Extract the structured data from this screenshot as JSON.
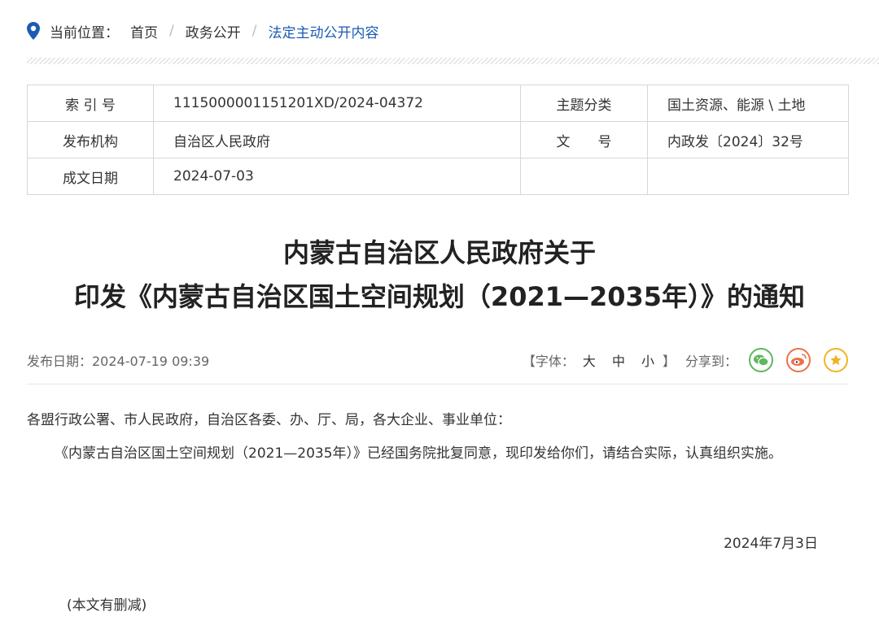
{
  "breadcrumb": {
    "label": "当前位置：",
    "items": [
      "首页",
      "政务公开",
      "法定主动公开内容"
    ],
    "separator": "/"
  },
  "meta": {
    "index_label": "索 引 号",
    "index_value": "1115000001151201XD/2024-04372",
    "topic_label": "主题分类",
    "topic_value": "国土资源、能源 \\ 土地",
    "org_label": "发布机构",
    "org_value": "自治区人民政府",
    "docno_label": "文　　号",
    "docno_value": "内政发〔2024〕32号",
    "date_label": "成文日期",
    "date_value": "2024-07-03"
  },
  "article": {
    "title_line1": "内蒙古自治区人民政府关于",
    "title_line2": "印发《内蒙古自治区国土空间规划（2021—2035年）》的通知",
    "publish_date": "发布日期：2024-07-19 09:39",
    "font_label": "【字体：",
    "font_large": "大",
    "font_medium": "中",
    "font_small": "小",
    "font_end": "】",
    "share_label": "分享到：",
    "salutation": "各盟行政公署、市人民政府，自治区各委、办、厅、局，各大企业、事业单位：",
    "paragraph": "《内蒙古自治区国土空间规划（2021—2035年）》已经国务院批复同意，现印发给你们，请结合实际，认真组织实施。",
    "sign_date": "2024年7月3日",
    "note": "(本文有删减)"
  },
  "icons": {
    "location": "location-pin-icon",
    "wechat": "wechat-icon",
    "weibo": "weibo-icon",
    "favorite": "star-icon"
  },
  "colors": {
    "accent": "#1b5bb3",
    "wechat": "#5cb85c",
    "weibo": "#e8734a",
    "star": "#f0b323"
  }
}
